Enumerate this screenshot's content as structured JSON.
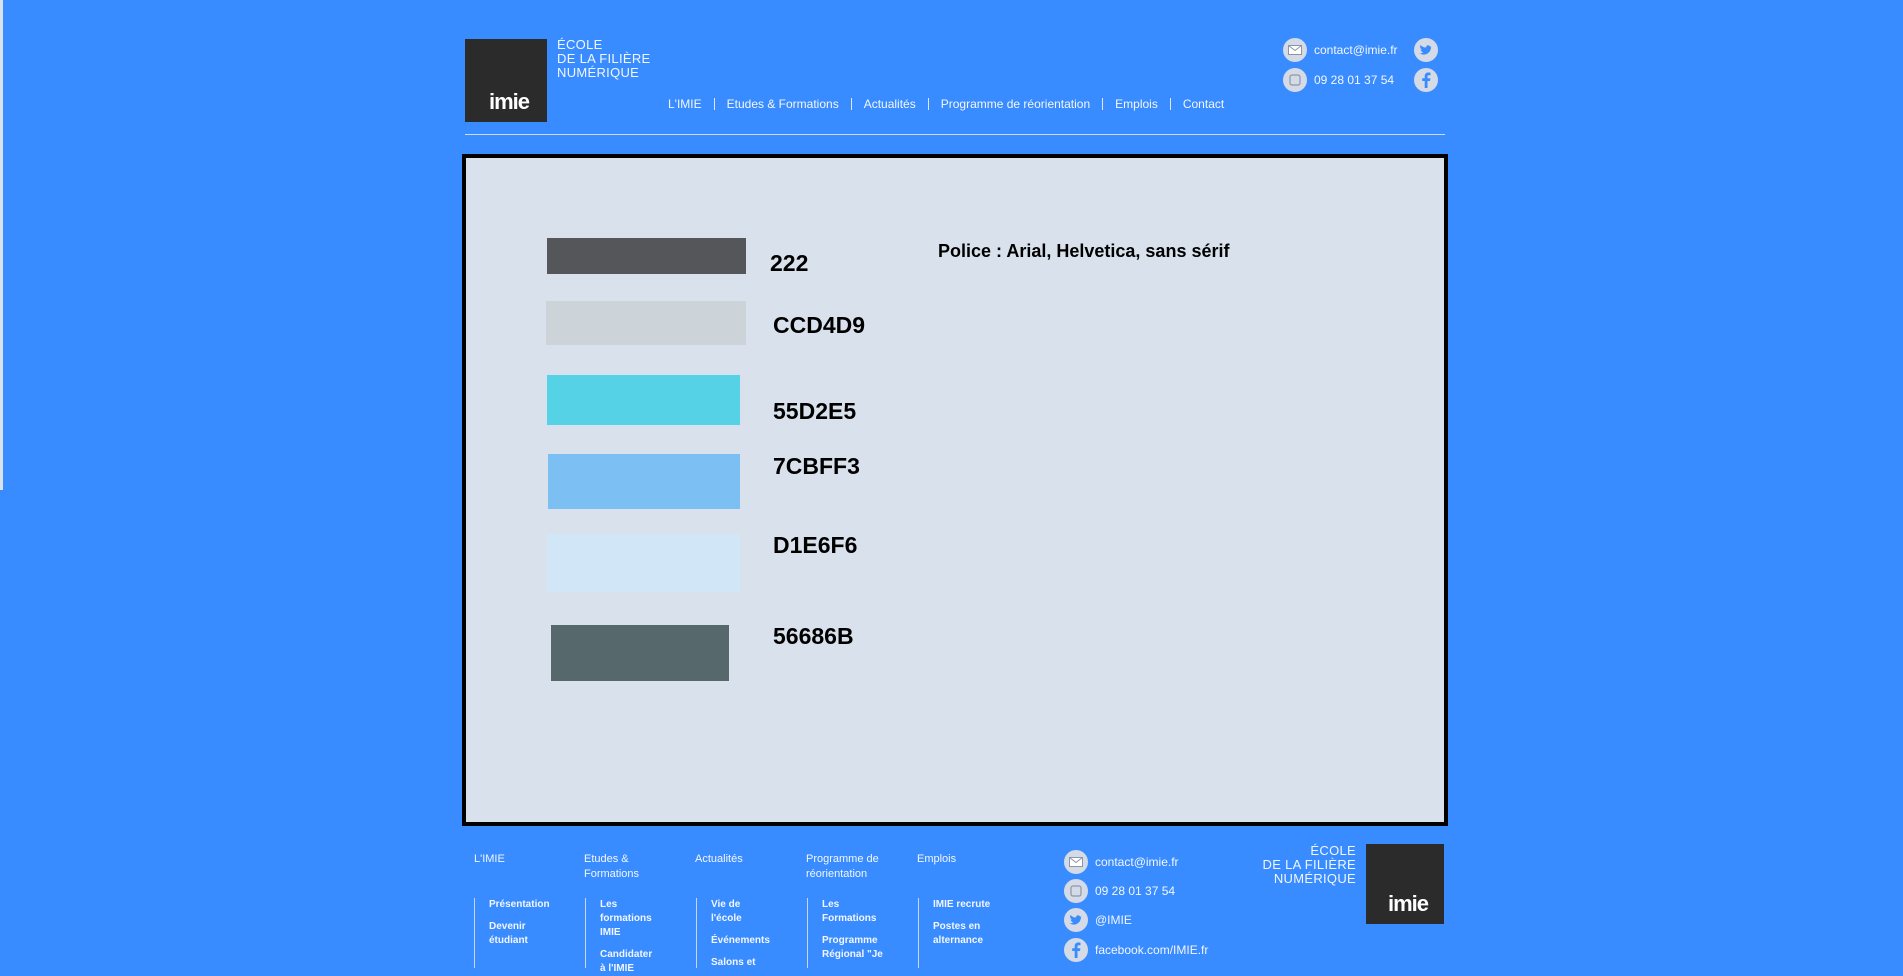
{
  "brand": {
    "logo_word": "imie",
    "school_lines": [
      "ÉCOLE",
      "DE LA FILIÈRE",
      "NUMÉRIQUE"
    ]
  },
  "header": {
    "nav": [
      "L'IMIE",
      "Etudes & Formations",
      "Actualités",
      "Programme de réorientation",
      "Emplois",
      "Contact"
    ],
    "email": "contact@imie.fr",
    "phone": "09 28 01 37 54",
    "social": [
      "twitter-icon",
      "facebook-icon"
    ]
  },
  "palette": {
    "swatches": [
      {
        "color": "#55565a",
        "code": "222"
      },
      {
        "color": "#ccd4d9",
        "code": "CCD4D9"
      },
      {
        "color": "#55d2e5",
        "code": "55D2E5"
      },
      {
        "color": "#7cbff3",
        "code": "7CBFF3"
      },
      {
        "color": "#d1e6f6",
        "code": "D1E6F6"
      },
      {
        "color": "#56686b",
        "code": "56686B"
      }
    ],
    "font_note": "Police : Arial, Helvetica, sans sérif"
  },
  "footer": {
    "headings": [
      "L'IMIE",
      "Etudes & Formations",
      "Actualités",
      "Programme de réorientation",
      "Emplois"
    ],
    "columns": [
      [
        "Présentation",
        "Devenir étudiant"
      ],
      [
        "Les formations IMIE",
        "Candidater à l'IMIE"
      ],
      [
        "Vie de l'école",
        "Événements",
        "Salons et"
      ],
      [
        "Les Formations",
        "Programme Régional \"Je"
      ],
      [
        "IMIE recrute",
        "Postes en alternance"
      ]
    ],
    "email": "contact@imie.fr",
    "phone": "09 28 01 37 54",
    "twitter": "@IMIE",
    "facebook": "facebook.com/IMIE.fr"
  },
  "colors": {
    "background": "#398cff",
    "panel": "#d9e2ec",
    "logo_box": "#2b2b2b"
  }
}
